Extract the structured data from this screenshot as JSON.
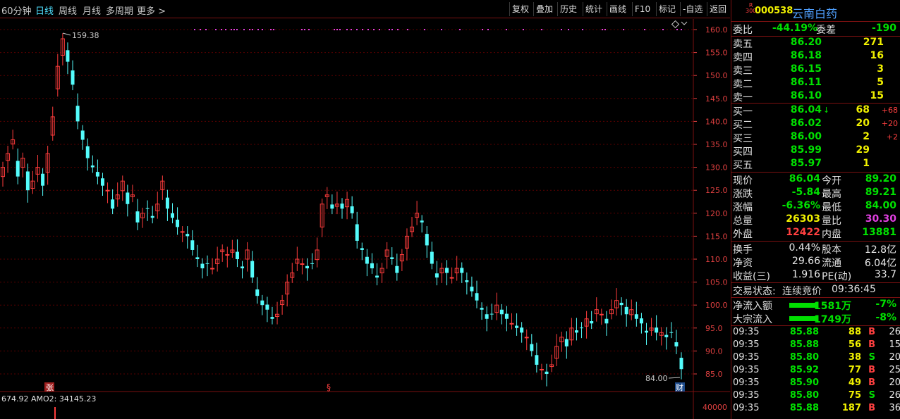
{
  "toolbar": {
    "periods": [
      "60分钟",
      "日线",
      "周线",
      "月线",
      "多周期",
      "更多 >"
    ],
    "active_period": 1,
    "tools": [
      "复权",
      "叠加",
      "历史",
      "统计",
      "画线",
      "F10",
      "标记",
      "-自选",
      "返回"
    ]
  },
  "chart": {
    "price_ticks": [
      "160.0",
      "155.0",
      "150.0",
      "145.0",
      "140.0",
      "135.0",
      "130.0",
      "125.0",
      "120.0",
      "115.0",
      "110.0",
      "105.0",
      "100.0",
      "95.0",
      "90.0",
      "85.0"
    ],
    "high_label": "159.38",
    "low_label": "84.00",
    "markers": [
      "张",
      "§",
      "财"
    ],
    "indicator_label": "674.92 AMO2: 34145.23",
    "indicator_tick": "40000",
    "colors": {
      "up": "#ff3c3c",
      "down": "#54fcfc",
      "grid": "#5a0000"
    }
  },
  "chart_data": {
    "type": "candlestick",
    "y_axis_ticks": [
      160,
      155,
      150,
      145,
      140,
      135,
      130,
      125,
      120,
      115,
      110,
      105,
      100,
      95,
      90,
      85
    ],
    "ylim": [
      83,
      161
    ],
    "highest": 159.38,
    "lowest": 84.0,
    "closes": [
      130,
      133,
      136,
      128,
      132,
      125,
      127,
      130,
      126,
      133,
      141,
      152,
      158,
      153,
      148,
      140,
      136,
      132,
      130,
      128,
      126,
      125,
      121,
      124,
      127,
      122,
      124,
      118,
      120,
      121,
      119,
      122,
      127,
      121,
      119,
      117,
      116,
      115,
      112,
      110,
      108,
      109,
      108,
      110,
      112,
      111,
      112,
      110,
      108,
      112,
      106,
      102,
      100,
      99,
      97,
      98,
      101,
      105,
      107,
      110,
      109,
      108,
      109,
      112,
      122,
      124,
      121,
      122,
      121,
      123,
      120,
      114,
      112,
      109,
      108,
      106,
      108,
      112,
      110,
      107,
      111,
      115,
      117,
      120,
      118,
      113,
      109,
      106,
      108,
      107,
      106,
      108,
      107,
      105,
      103,
      101,
      99,
      97,
      98,
      100,
      98,
      97,
      96,
      95,
      94,
      93,
      90,
      87,
      86,
      85,
      87,
      91,
      93,
      91,
      95,
      94,
      95,
      97,
      96,
      99,
      98,
      96,
      99,
      101,
      100,
      98,
      99,
      97,
      96,
      94,
      95,
      94,
      94,
      93,
      94,
      91,
      86.04
    ]
  },
  "panel": {
    "index_badge_top": "R",
    "index_badge_bottom": "300",
    "code": "000538",
    "name": "云南白药",
    "weibi_label": "委比",
    "weibi_value": "-44.19%",
    "weicha_label": "委差",
    "weicha_value": "-190",
    "asks": [
      {
        "label": "卖五",
        "price": "86.20",
        "vol": "271"
      },
      {
        "label": "卖四",
        "price": "86.18",
        "vol": "16"
      },
      {
        "label": "卖三",
        "price": "86.15",
        "vol": "3"
      },
      {
        "label": "卖二",
        "price": "86.11",
        "vol": "5"
      },
      {
        "label": "卖一",
        "price": "86.10",
        "vol": "15"
      }
    ],
    "bids": [
      {
        "label": "买一",
        "price": "86.04",
        "arrow": "↓",
        "vol": "68",
        "chg": "+68"
      },
      {
        "label": "买二",
        "price": "86.02",
        "arrow": "",
        "vol": "20",
        "chg": "+20"
      },
      {
        "label": "买三",
        "price": "86.00",
        "arrow": "",
        "vol": "2",
        "chg": "+2"
      },
      {
        "label": "买四",
        "price": "85.99",
        "arrow": "",
        "vol": "29",
        "chg": ""
      },
      {
        "label": "买五",
        "price": "85.97",
        "arrow": "",
        "vol": "1",
        "chg": ""
      }
    ],
    "quote": [
      {
        "l1": "现价",
        "v1": "86.04",
        "c1": "green",
        "l2": "今开",
        "v2": "89.20",
        "c2": "green"
      },
      {
        "l1": "涨跌",
        "v1": "-5.84",
        "c1": "green",
        "l2": "最高",
        "v2": "89.21",
        "c2": "green"
      },
      {
        "l1": "涨幅",
        "v1": "-6.36%",
        "c1": "green",
        "l2": "最低",
        "v2": "84.00",
        "c2": "green"
      },
      {
        "l1": "总量",
        "v1": "26303",
        "c1": "yellow",
        "l2": "量比",
        "v2": "30.30",
        "c2": "magenta"
      },
      {
        "l1": "外盘",
        "v1": "12422",
        "c1": "red",
        "l2": "内盘",
        "v2": "13881",
        "c2": "green"
      }
    ],
    "fund": [
      {
        "l1": "换手",
        "v1": "0.44%",
        "l2": "股本",
        "v2": "12.8亿"
      },
      {
        "l1": "净资",
        "v1": "29.66",
        "l2": "流通",
        "v2": "6.04亿"
      },
      {
        "l1": "收益(三)",
        "v1": "1.916",
        "l2": "PE(动)",
        "v2": "33.7"
      }
    ],
    "status_label": "交易状态:",
    "status_value": "连续竞价",
    "status_time": "09:36:45",
    "flows": [
      {
        "label": "净流入额",
        "value": "-1581万",
        "pct": "-7%"
      },
      {
        "label": "大宗流入",
        "value": "-1749万",
        "pct": "-8%"
      }
    ],
    "ticks": [
      {
        "time": "09:35",
        "price": "85.88",
        "vol": "88",
        "side": "B",
        "n": "26"
      },
      {
        "time": "09:35",
        "price": "85.88",
        "vol": "56",
        "side": "B",
        "n": "15"
      },
      {
        "time": "09:35",
        "price": "85.80",
        "vol": "38",
        "side": "S",
        "n": "20"
      },
      {
        "time": "09:35",
        "price": "85.92",
        "vol": "77",
        "side": "B",
        "n": "25"
      },
      {
        "time": "09:35",
        "price": "85.90",
        "vol": "49",
        "side": "B",
        "n": "20"
      },
      {
        "time": "09:35",
        "price": "85.80",
        "vol": "75",
        "side": "S",
        "n": "26"
      },
      {
        "time": "09:35",
        "price": "85.88",
        "vol": "187",
        "side": "B",
        "n": "36"
      }
    ]
  }
}
